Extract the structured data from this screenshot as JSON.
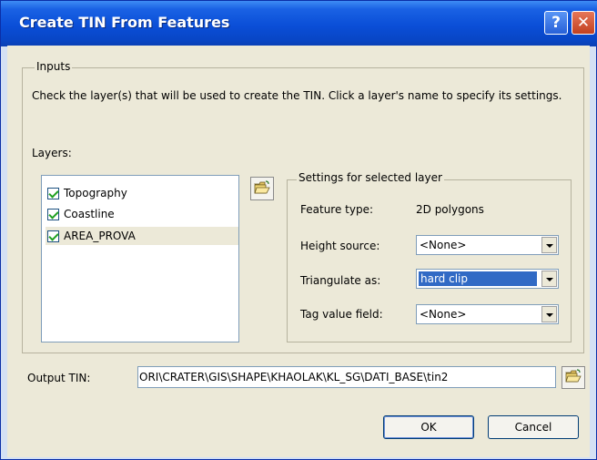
{
  "window": {
    "title": "Create TIN From Features",
    "help_glyph": "?",
    "close_glyph": "✕"
  },
  "inputs": {
    "group_label": "Inputs",
    "description": "Check the layer(s) that will be used to create the TIN.  Click a layer's name to specify its settings.",
    "layers_label": "Layers:",
    "layers": [
      {
        "name": "Topography",
        "checked": true
      },
      {
        "name": "Coastline",
        "checked": true
      },
      {
        "name": "AREA_PROVA",
        "checked": true,
        "selected": true
      }
    ]
  },
  "settings": {
    "group_label": "Settings for selected layer",
    "feature_type_label": "Feature type:",
    "feature_type_value": "2D polygons",
    "height_source_label": "Height source:",
    "height_source_value": "<None>",
    "triangulate_label": "Triangulate as:",
    "triangulate_value": "hard clip",
    "tag_value_label": "Tag value field:",
    "tag_value_value": "<None>"
  },
  "output": {
    "label": "Output TIN:",
    "value": "ORI\\CRATER\\GIS\\SHAPE\\KHAOLAK\\KL_SG\\DATI_BASE\\tin2"
  },
  "buttons": {
    "ok": "OK",
    "cancel": "Cancel"
  },
  "icons": {
    "open_folder": "folder-open-icon"
  },
  "colors": {
    "titlebar": "#0a4ed7",
    "dialog_bg": "#ece9d8",
    "selection": "#316ac5",
    "check": "#21a121"
  }
}
